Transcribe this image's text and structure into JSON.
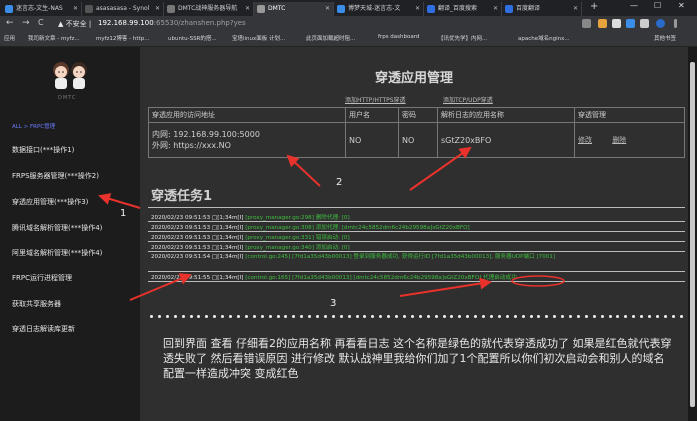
{
  "browser": {
    "tabs": [
      {
        "label": "迷言志-文生-NAS",
        "color": "#3b8ee8"
      },
      {
        "label": "asasasasa - Synol",
        "color": "#555"
      },
      {
        "label": "DMTC战神服务器导航",
        "color": "#777"
      },
      {
        "label": "DMTC",
        "color": "#999",
        "active": true
      },
      {
        "label": "博梦天城-迷言志-文",
        "color": "#3b8ee8"
      },
      {
        "label": "翻译_百度搜索",
        "color": "#2f6fe0"
      },
      {
        "label": "百度翻译",
        "color": "#2f6fe0"
      }
    ],
    "new_tab": "+",
    "window_controls": [
      "—",
      "☐",
      "✕"
    ],
    "nav_icons": [
      "←",
      "→",
      "C"
    ],
    "security_label": "▲ 不安全 |",
    "url_host": "192.168.99.100",
    "url_rest": ":65530/zhanshen.php?yes",
    "bookmarks": [
      "应用",
      "我司新文章 - myfz...",
      "myfz12博客 - http...",
      "ubuntu-SSR的搭...",
      "宝塔linux面板 计划...",
      "此页面加载超时阻...",
      "frps dashboard",
      "【讯优先学】内网...",
      "apache域名nginx...",
      "其他书签"
    ]
  },
  "sidebar": {
    "logo_text": "DMTC",
    "breadcrumb": "ALL > FRPC管理",
    "items": [
      {
        "label": "数据接口(***操作1)"
      },
      {
        "label": "FRPS服务器管理(***操作2)"
      },
      {
        "label": "穿透应用管理(***操作3)"
      },
      {
        "label": "腾讯域名解析管理(***操作4)"
      },
      {
        "label": "阿里域名解析管理(***操作4)"
      },
      {
        "label": "FRPC运行进程管理"
      },
      {
        "label": "获取共享服务器"
      },
      {
        "label": "穿透日志解读库更新"
      }
    ]
  },
  "main": {
    "title": "穿透应用管理",
    "subtab_http": "添加HTTP/HTTPS穿透",
    "subtab_tcp": "添加TCP/UDP穿透",
    "table": {
      "headers": [
        "穿透应用的访问地址",
        "用户名",
        "密码",
        "解析日志的应用名称",
        "穿透管理"
      ],
      "row": {
        "inner": "内网: 192.168.99.100:5000",
        "outer": "外网: https://xxx.NO",
        "user": "NO",
        "pass": "NO",
        "app": "sGtZ20xBFO",
        "edit": "修改",
        "del": "删除"
      }
    },
    "task_title": "穿透任务1",
    "logs": [
      {
        "time": "2020/02/23 09:51:53",
        "tail": " [proxy_manager.go:298] 删除代理: [0]"
      },
      {
        "time": "2020/02/23 09:51:53",
        "tail": " [proxy_manager.go:308] 添加代理: [dmtc24c5852dm6c24b29598a]sGtZ20xBFO]"
      },
      {
        "time": "2020/02/23 09:51:53",
        "tail": " [proxy_manager.go:331] 错误启动: [0]"
      },
      {
        "time": "2020/02/23 09:51:53",
        "tail": " [proxy_manager.go:340] 添加启动: [0]"
      },
      {
        "time": "2020/02/23 09:51:54",
        "tail": " [control.go:245] [7fd1a35d43b00013] 登录到服务器成功, 获得运行ID [7fd1a35d43b00013], 服务器UDP端口 [7001]"
      },
      {
        "time": "2020/02/23 09:51:55",
        "tail": " [control.go:165] [7fd1a35d43b00013] [dmtc24c5852dm6c24b29598a]sGtZ20xBFO] 代理启动成功"
      }
    ],
    "log_mid": " □[1;34m[I] ",
    "note": "回到界面 查看 仔细看2的应用名称 再看看日志 这个名称是绿色的就代表穿透成功了 如果是红色就代表穿透失败了 然后看错误原因 进行修改 默认战神里我给你们加了1个配置所以你们初次启动会和别人的域名配置一样造成冲突 变成红色"
  },
  "annotations": [
    "1",
    "2",
    "3"
  ],
  "colors": {
    "arrow": "#e8322b",
    "log_green": "#3fbf3f",
    "link_blue": "#6a7cff"
  }
}
